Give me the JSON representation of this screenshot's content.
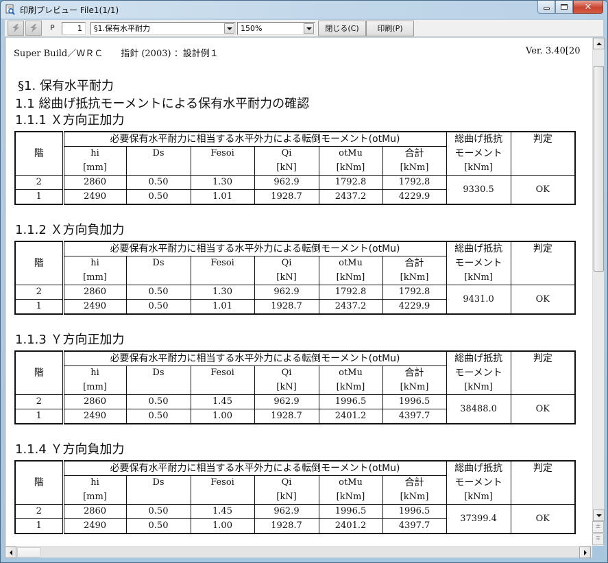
{
  "window": {
    "title": "印刷プレビュー File1(1/1)",
    "controls": {
      "minimize": "minimize",
      "maximize": "maximize",
      "close": "close"
    }
  },
  "toolbar": {
    "prev_icon": "lightning-prev-icon",
    "next_icon": "lightning-next-icon",
    "page_label": "P",
    "page_value": "1",
    "section_select": "§1.保有水平耐力",
    "zoom_select": "150%",
    "close_button": "閉じる(C)",
    "print_button": "印刷(P)"
  },
  "document": {
    "header_left": "Super Build／ＷＲＣ　　指針 (2003) ：設計例１",
    "header_right": "Ver. 3.40[20",
    "section_title": "§1. 保有水平耐力",
    "subsection_title": "1.1 総曲げ抵抗モーメントによる保有水平耐力の確認",
    "column_headers": {
      "story": "階",
      "group": "必要保有水平耐力に相当する水平外力による転倒モーメント(otMu)",
      "hi": "hi",
      "hi_unit": "[mm]",
      "ds": "Ds",
      "fesoi": "Fesoi",
      "qi": "Qi",
      "qi_unit": "[kN]",
      "otmu": "otMu",
      "otmu_unit": "[kNm]",
      "total": "合計",
      "total_unit": "[kNm]",
      "resist_1": "総曲げ抵抗",
      "resist_2": "モーメント",
      "resist_unit": "[kNm]",
      "judge": "判定"
    },
    "tables": [
      {
        "title": "1.1.1 Ｘ方向正加力",
        "rows": [
          {
            "story": "2",
            "hi": "2860",
            "ds": "0.50",
            "fesoi": "1.30",
            "qi": "962.9",
            "otmu": "1792.8",
            "total": "1792.8"
          },
          {
            "story": "1",
            "hi": "2490",
            "ds": "0.50",
            "fesoi": "1.01",
            "qi": "1928.7",
            "otmu": "2437.2",
            "total": "4229.9"
          }
        ],
        "resist": "9330.5",
        "judge": "OK"
      },
      {
        "title": "1.1.2 Ｘ方向負加力",
        "rows": [
          {
            "story": "2",
            "hi": "2860",
            "ds": "0.50",
            "fesoi": "1.30",
            "qi": "962.9",
            "otmu": "1792.8",
            "total": "1792.8"
          },
          {
            "story": "1",
            "hi": "2490",
            "ds": "0.50",
            "fesoi": "1.01",
            "qi": "1928.7",
            "otmu": "2437.2",
            "total": "4229.9"
          }
        ],
        "resist": "9431.0",
        "judge": "OK"
      },
      {
        "title": "1.1.3 Ｙ方向正加力",
        "rows": [
          {
            "story": "2",
            "hi": "2860",
            "ds": "0.50",
            "fesoi": "1.45",
            "qi": "962.9",
            "otmu": "1996.5",
            "total": "1996.5"
          },
          {
            "story": "1",
            "hi": "2490",
            "ds": "0.50",
            "fesoi": "1.00",
            "qi": "1928.7",
            "otmu": "2401.2",
            "total": "4397.7"
          }
        ],
        "resist": "38488.0",
        "judge": "OK"
      },
      {
        "title": "1.1.4 Ｙ方向負加力",
        "rows": [
          {
            "story": "2",
            "hi": "2860",
            "ds": "0.50",
            "fesoi": "1.45",
            "qi": "962.9",
            "otmu": "1996.5",
            "total": "1996.5"
          },
          {
            "story": "1",
            "hi": "2490",
            "ds": "0.50",
            "fesoi": "1.00",
            "qi": "1928.7",
            "otmu": "2401.2",
            "total": "4397.7"
          }
        ],
        "resist": "37399.4",
        "judge": "OK"
      }
    ]
  },
  "scrollbars": {
    "page_up_symbol": "±",
    "page_down_symbol": "∓"
  }
}
